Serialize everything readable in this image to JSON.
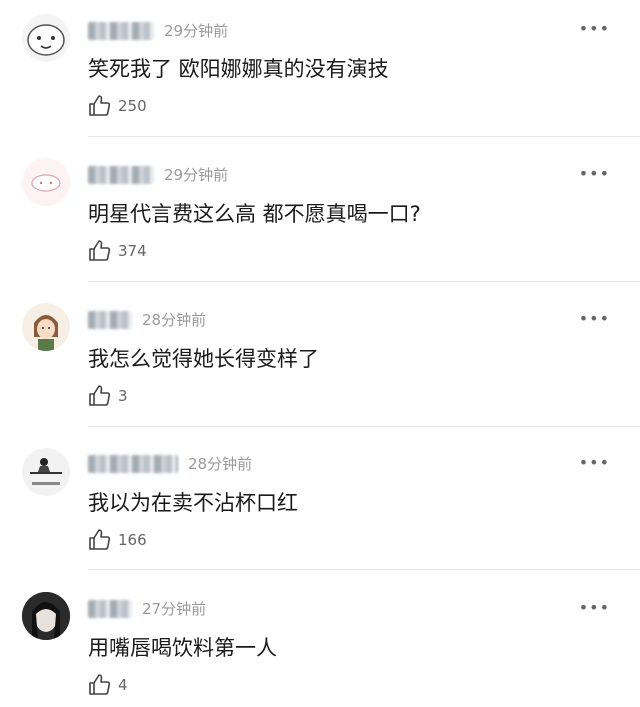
{
  "comments": [
    {
      "time": "29分钟前",
      "text": "笑死我了 欧阳娜娜真的没有演技",
      "likes": "250",
      "more_label": "•••",
      "like_icon": "thumbs-up-icon"
    },
    {
      "time": "29分钟前",
      "text": "明星代言费这么高 都不愿真喝一口?",
      "likes": "374",
      "more_label": "•••",
      "like_icon": "thumbs-up-icon"
    },
    {
      "time": "28分钟前",
      "text": "我怎么觉得她长得变样了",
      "likes": "3",
      "more_label": "•••",
      "like_icon": "thumbs-up-icon"
    },
    {
      "time": "28分钟前",
      "text": "我以为在卖不沾杯口红",
      "likes": "166",
      "more_label": "•••",
      "like_icon": "thumbs-up-icon"
    },
    {
      "time": "27分钟前",
      "text": "用嘴唇喝饮料第一人",
      "likes": "4",
      "more_label": "•••",
      "like_icon": "thumbs-up-icon"
    }
  ]
}
